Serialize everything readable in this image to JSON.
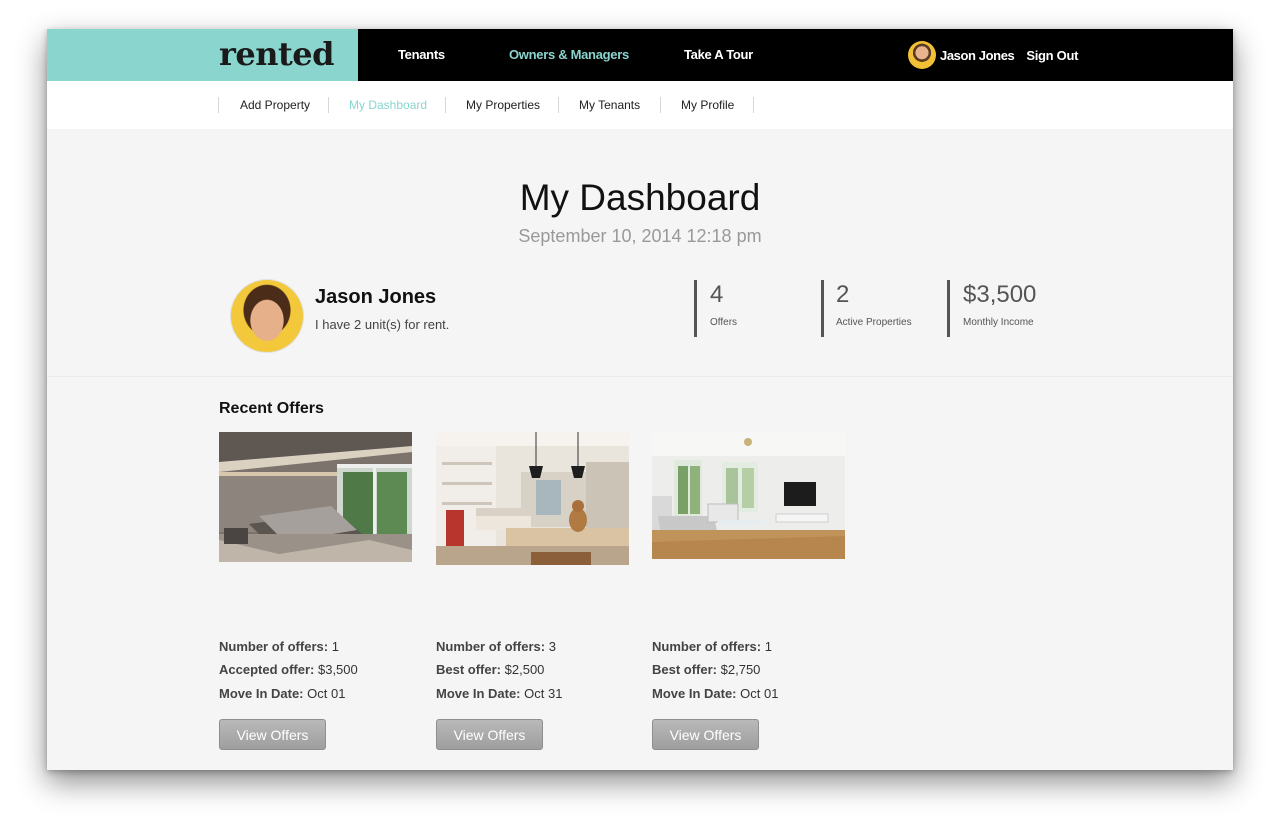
{
  "brand": {
    "logo": "rented",
    "accent": "#8ad5ce"
  },
  "top_nav": {
    "links": [
      "Tenants",
      "Owners & Managers",
      "Take A Tour"
    ],
    "active": "Owners & Managers",
    "user_name": "Jason Jones",
    "sign_out": "Sign Out"
  },
  "sub_nav": {
    "items": [
      "Add Property",
      "My Dashboard",
      "My Properties",
      "My Tenants",
      "My Profile"
    ],
    "active": "My Dashboard"
  },
  "header": {
    "title": "My Dashboard",
    "datetime": "September 10, 2014 12:18 pm"
  },
  "profile": {
    "name": "Jason Jones",
    "subtitle": "I have 2 unit(s) for rent."
  },
  "stats": [
    {
      "value": "4",
      "label": "Offers"
    },
    {
      "value": "2",
      "label": "Active Properties"
    },
    {
      "value": "$3,500",
      "label": "Monthly Income"
    }
  ],
  "recent_offers": {
    "title": "Recent Offers",
    "items": [
      {
        "image": "bedroom-photo",
        "lines": [
          {
            "label": "Number of offers:",
            "value": "1"
          },
          {
            "label": "Accepted offer:",
            "value": "$3,500"
          },
          {
            "label": "Move In Date:",
            "value": "Oct 01"
          }
        ],
        "button": "View Offers"
      },
      {
        "image": "kitchen-living-photo",
        "lines": [
          {
            "label": "Number of offers:",
            "value": "3"
          },
          {
            "label": "Best offer:",
            "value": "$2,500"
          },
          {
            "label": "Move In Date:",
            "value": "Oct 31"
          }
        ],
        "button": "View Offers"
      },
      {
        "image": "living-room-photo",
        "lines": [
          {
            "label": "Number of offers:",
            "value": "1"
          },
          {
            "label": "Best offer:",
            "value": "$2,750"
          },
          {
            "label": "Move In Date:",
            "value": "Oct 01"
          }
        ],
        "button": "View Offers"
      }
    ]
  }
}
